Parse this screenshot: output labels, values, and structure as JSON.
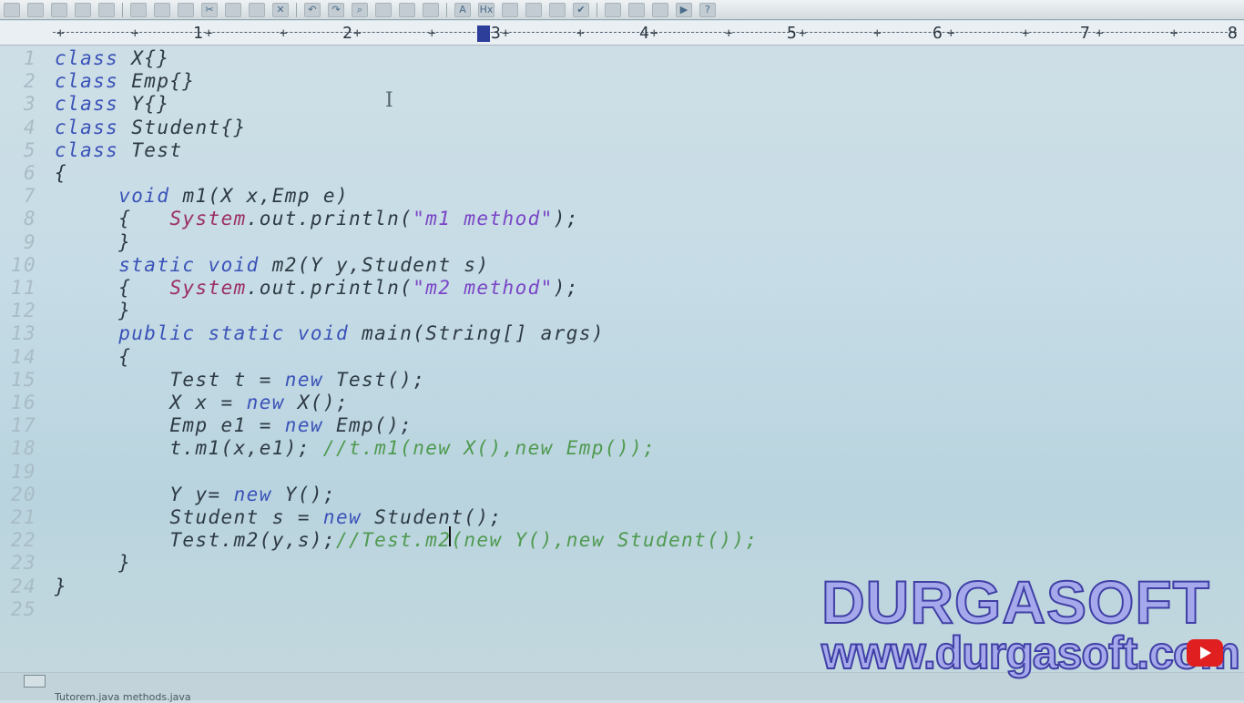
{
  "toolbar": {
    "icons": [
      "new-icon",
      "open-icon",
      "save-icon",
      "save-all-icon",
      "close-file-icon",
      "print-icon",
      "print-preview-icon",
      "spellcheck-icon",
      "cut-icon",
      "copy-icon",
      "paste-icon",
      "delete-icon",
      "undo-icon",
      "redo-icon",
      "find-icon",
      "replace-icon",
      "find-in-files-icon",
      "goto-icon",
      "font-size-icon",
      "hex-icon",
      "column-icon",
      "wordwrap-icon",
      "list-icon",
      "checkmark-icon",
      "window-icon",
      "window-tile-icon",
      "window-cascade-icon",
      "run-icon",
      "help-icon"
    ]
  },
  "ruler": {
    "numbers": [
      "1",
      "2",
      "3",
      "4",
      "5",
      "6",
      "7",
      "8"
    ]
  },
  "editor": {
    "lines": [
      {
        "n": "1",
        "code": "class X{}"
      },
      {
        "n": "2",
        "code": "class Emp{}"
      },
      {
        "n": "3",
        "code": "class Y{}"
      },
      {
        "n": "4",
        "code": "class Student{}"
      },
      {
        "n": "5",
        "code": "class Test"
      },
      {
        "n": "6",
        "code": "{"
      },
      {
        "n": "7",
        "code": "     void m1(X x,Emp e)"
      },
      {
        "n": "8",
        "code": "     {   System.out.println(\"m1 method\");"
      },
      {
        "n": "9",
        "code": "     }"
      },
      {
        "n": "10",
        "code": "     static void m2(Y y,Student s)"
      },
      {
        "n": "11",
        "code": "     {   System.out.println(\"m2 method\");"
      },
      {
        "n": "12",
        "code": "     }"
      },
      {
        "n": "13",
        "code": "     public static void main(String[] args)"
      },
      {
        "n": "14",
        "code": "     {"
      },
      {
        "n": "15",
        "code": "         Test t = new Test();"
      },
      {
        "n": "16",
        "code": "         X x = new X();"
      },
      {
        "n": "17",
        "code": "         Emp e1 = new Emp();"
      },
      {
        "n": "18",
        "code": "         t.m1(x,e1); //t.m1(new X(),new Emp());"
      },
      {
        "n": "19",
        "code": ""
      },
      {
        "n": "20",
        "code": "         Y y= new Y();"
      },
      {
        "n": "21",
        "code": "         Student s = new Student();"
      },
      {
        "n": "22",
        "code": "         Test.m2(y,s);//Test.m2(new Y(),new Student());"
      },
      {
        "n": "23",
        "code": "     }"
      },
      {
        "n": "24",
        "code": "}"
      },
      {
        "n": "25",
        "code": ""
      }
    ]
  },
  "status": {
    "tabs": "Tutorem.java    methods.java"
  },
  "watermark": {
    "title": "DURGASOFT",
    "url": "www.durgasoft.com",
    "logo": "youtube-icon"
  },
  "colors": {
    "keyword": "#3a52b8",
    "system": "#9c2f63",
    "string": "#7a45c6",
    "comment": "#4f9a50",
    "text": "#2d3a44"
  }
}
